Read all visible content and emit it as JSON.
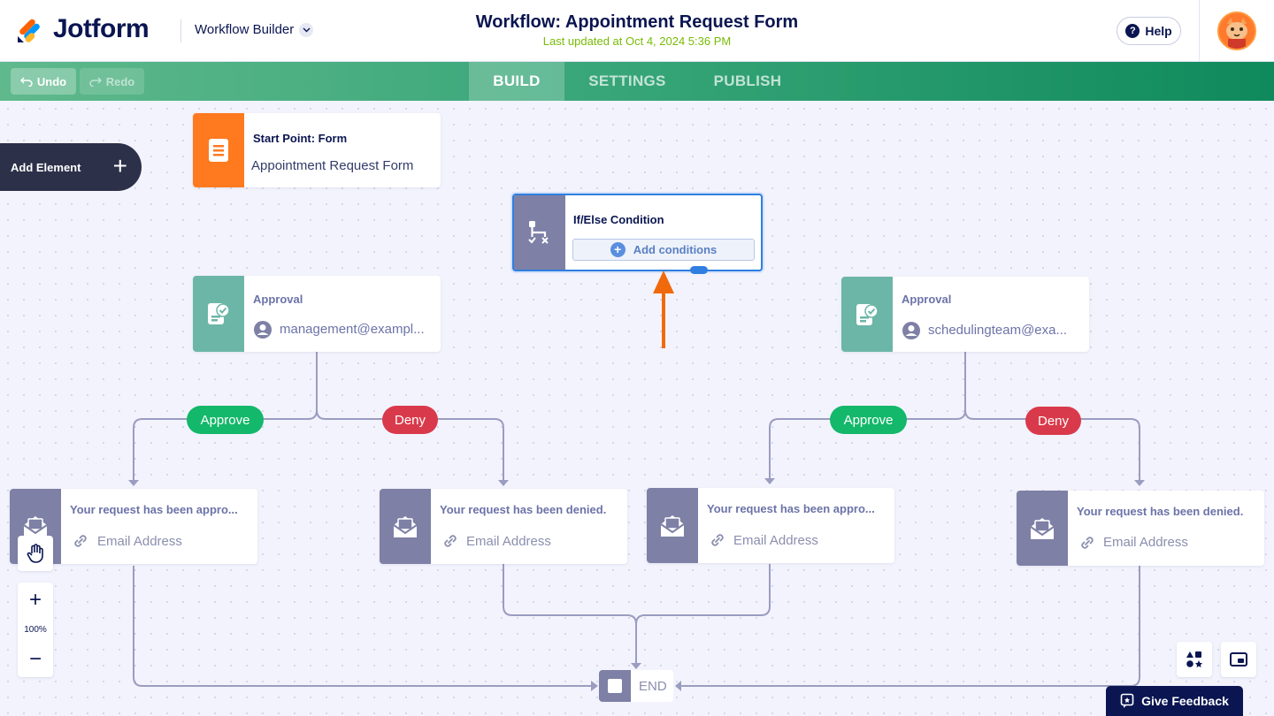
{
  "header": {
    "logo_text": "Jotform",
    "builder_label": "Workflow Builder",
    "title": "Workflow: Appointment Request Form",
    "last_updated": "Last updated at Oct 4, 2024 5:36 PM",
    "help_label": "Help"
  },
  "toolbar": {
    "undo_label": "Undo",
    "redo_label": "Redo",
    "tabs": [
      {
        "label": "BUILD",
        "active": true
      },
      {
        "label": "SETTINGS",
        "active": false
      },
      {
        "label": "PUBLISH",
        "active": false
      }
    ]
  },
  "sidebar": {
    "add_element_label": "Add Element"
  },
  "nodes": {
    "start": {
      "title": "Start Point: Form",
      "subtitle": "Appointment Request Form"
    },
    "condition": {
      "title": "If/Else Condition",
      "button_label": "Add conditions"
    },
    "approval_left": {
      "title": "Approval",
      "assignee": "management@exampl..."
    },
    "approval_right": {
      "title": "Approval",
      "assignee": "schedulingteam@exa..."
    },
    "email_1": {
      "title": "Your request has been appro...",
      "field": "Email Address"
    },
    "email_2": {
      "title": "Your request has been denied.",
      "field": "Email Address"
    },
    "email_3": {
      "title": "Your request has been appro...",
      "field": "Email Address"
    },
    "email_4": {
      "title": "Your request has been denied.",
      "field": "Email Address"
    },
    "end": {
      "label": "END"
    }
  },
  "branches": {
    "approve_label": "Approve",
    "deny_label": "Deny"
  },
  "controls": {
    "zoom_level": "100%",
    "zoom_in": "+",
    "zoom_out": "−",
    "feedback_label": "Give Feedback"
  },
  "colors": {
    "brand_navy": "#0a1551",
    "approve": "#13b86a",
    "deny": "#d93a4b",
    "start_orange": "#ff7a1f",
    "approval_teal": "#6cb6a8",
    "selection_blue": "#2e7fe0",
    "annotation_arrow": "#f06a0c"
  }
}
